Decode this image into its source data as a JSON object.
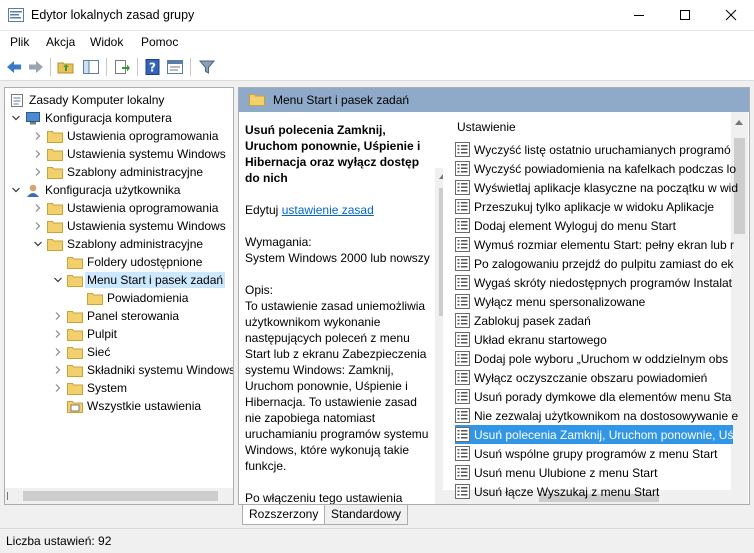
{
  "window": {
    "title": "Edytor lokalnych zasad grupy"
  },
  "menu": [
    "Plik",
    "Akcja",
    "Widok",
    "Pomoc"
  ],
  "tree": [
    {
      "label": "Zasady Komputer lokalny",
      "level": 0,
      "icon": "document-icon"
    },
    {
      "label": "Konfiguracja komputera",
      "level": 1,
      "icon": "computer-icon",
      "exp": "open"
    },
    {
      "label": "Ustawienia oprogramowania",
      "level": 2,
      "icon": "folder-icon",
      "exp": "closed"
    },
    {
      "label": "Ustawienia systemu Windows",
      "level": 2,
      "icon": "folder-icon",
      "exp": "closed"
    },
    {
      "label": "Szablony administracyjne",
      "level": 2,
      "icon": "folder-icon",
      "exp": "closed"
    },
    {
      "label": "Konfiguracja użytkownika",
      "level": 1,
      "icon": "user-icon",
      "exp": "open"
    },
    {
      "label": "Ustawienia oprogramowania",
      "level": 2,
      "icon": "folder-icon",
      "exp": "closed"
    },
    {
      "label": "Ustawienia systemu Windows",
      "level": 2,
      "icon": "folder-icon",
      "exp": "closed"
    },
    {
      "label": "Szablony administracyjne",
      "level": 2,
      "icon": "folder-icon",
      "exp": "open"
    },
    {
      "label": "Foldery udostępnione",
      "level": 3,
      "icon": "folder-icon",
      "exp": ""
    },
    {
      "label": "Menu Start i pasek zadań",
      "level": 3,
      "icon": "folder-icon",
      "exp": "open",
      "selected": true
    },
    {
      "label": "Powiadomienia",
      "level": 4,
      "icon": "folder-icon",
      "exp": ""
    },
    {
      "label": "Panel sterowania",
      "level": 3,
      "icon": "folder-icon",
      "exp": "closed"
    },
    {
      "label": "Pulpit",
      "level": 3,
      "icon": "folder-icon",
      "exp": "closed"
    },
    {
      "label": "Sieć",
      "level": 3,
      "icon": "folder-icon",
      "exp": "closed"
    },
    {
      "label": "Składniki systemu Windows",
      "level": 3,
      "icon": "folder-icon",
      "exp": "closed"
    },
    {
      "label": "System",
      "level": 3,
      "icon": "folder-icon",
      "exp": "closed"
    },
    {
      "label": "Wszystkie ustawienia",
      "level": 3,
      "icon": "settings-folder-icon",
      "exp": ""
    }
  ],
  "header": {
    "title": "Menu Start i pasek zadań"
  },
  "description": {
    "title": "Usuń polecenia Zamknij, Uruchom ponownie, Uśpienie i Hibernacja oraz wyłącz dostęp do nich",
    "edit_prefix": "Edytuj",
    "edit_link": "ustawienie zasad",
    "req_label": "Wymagania:",
    "req_value": "System Windows 2000 lub nowszy",
    "desc_label": "Opis:",
    "desc_text": "To ustawienie zasad uniemożliwia użytkownikom wykonanie następujących poleceń z menu Start lub z ekranu Zabezpieczenia systemu Windows: Zamknij, Uruchom ponownie, Uśpienie i Hibernacja. To ustawienie zasad nie zapobiega natomiast uruchamianiu programów systemu Windows, które wykonują takie funkcje.",
    "more_text": "Po włączeniu tego ustawienia zasad, z menu Start usunięte zostaną przycisk zasilania oraz polecenia Zamknij, Uruchom"
  },
  "list": {
    "column": "Ustawienie",
    "items": [
      "Wyczyść listę ostatnio uruchamianych programó",
      "Wyczyść powiadomienia na kafelkach podczas lo",
      "Wyświetlaj aplikacje klasyczne na początku w wid",
      "Przeszukuj tylko aplikacje w widoku Aplikacje",
      "Dodaj element Wyloguj do menu Start",
      "Wymuś rozmiar elementu Start: pełny ekran lub r",
      "Po zalogowaniu przejdź do pulpitu zamiast do ek",
      "Wygaś skróty niedostępnych programów Instalat",
      "Wyłącz menu spersonalizowane",
      "Zablokuj pasek zadań",
      "Układ ekranu startowego",
      "Dodaj pole wyboru „Uruchom w oddzielnym obs",
      "Wyłącz oczyszczanie obszaru powiadomień",
      "Usuń porady dymkowe dla elementów menu Sta",
      "Nie zezwalaj użytkownikom na dostosowywanie e",
      "Usuń polecenia Zamknij, Uruchom ponownie, Uś",
      "Usuń wspólne grupy programów z menu Start",
      "Usuń menu Ulubione z menu Start",
      "Usuń łącze Wyszukaj z menu Start"
    ],
    "selected_index": 15
  },
  "tabs": [
    "Rozszerzony",
    "Standardowy"
  ],
  "status": {
    "text": "Liczba ustawień: 92"
  }
}
